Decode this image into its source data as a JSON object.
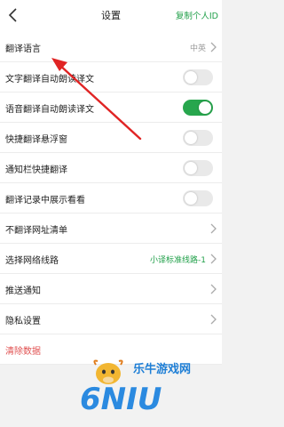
{
  "header": {
    "title": "设置",
    "action_label": "复制个人ID",
    "back_icon": "back-icon"
  },
  "rows": [
    {
      "label": "翻译语言",
      "value": "中英",
      "type": "nav"
    },
    {
      "label": "文字翻译自动朗读译文",
      "type": "toggle",
      "on": false
    },
    {
      "label": "语音翻译自动朗读译文",
      "type": "toggle",
      "on": true
    },
    {
      "label": "快捷翻译悬浮窗",
      "type": "toggle",
      "on": false
    },
    {
      "label": "通知栏快捷翻译",
      "type": "toggle",
      "on": false
    },
    {
      "label": "翻译记录中展示看看",
      "type": "toggle",
      "on": false
    },
    {
      "label": "不翻译网址清单",
      "type": "nav"
    },
    {
      "label": "选择网络线路",
      "value": "小译标准线路-1",
      "type": "nav"
    },
    {
      "label": "推送通知",
      "type": "nav"
    },
    {
      "label": "隐私设置",
      "type": "nav"
    },
    {
      "label": "清除数据",
      "type": "danger"
    }
  ],
  "watermark": {
    "logo_text": "6NIU",
    "site_text": "乐牛游戏网"
  },
  "colors": {
    "accent_green": "#27a64d",
    "danger_red": "#e05050",
    "annotation_arrow": "#e02424"
  }
}
